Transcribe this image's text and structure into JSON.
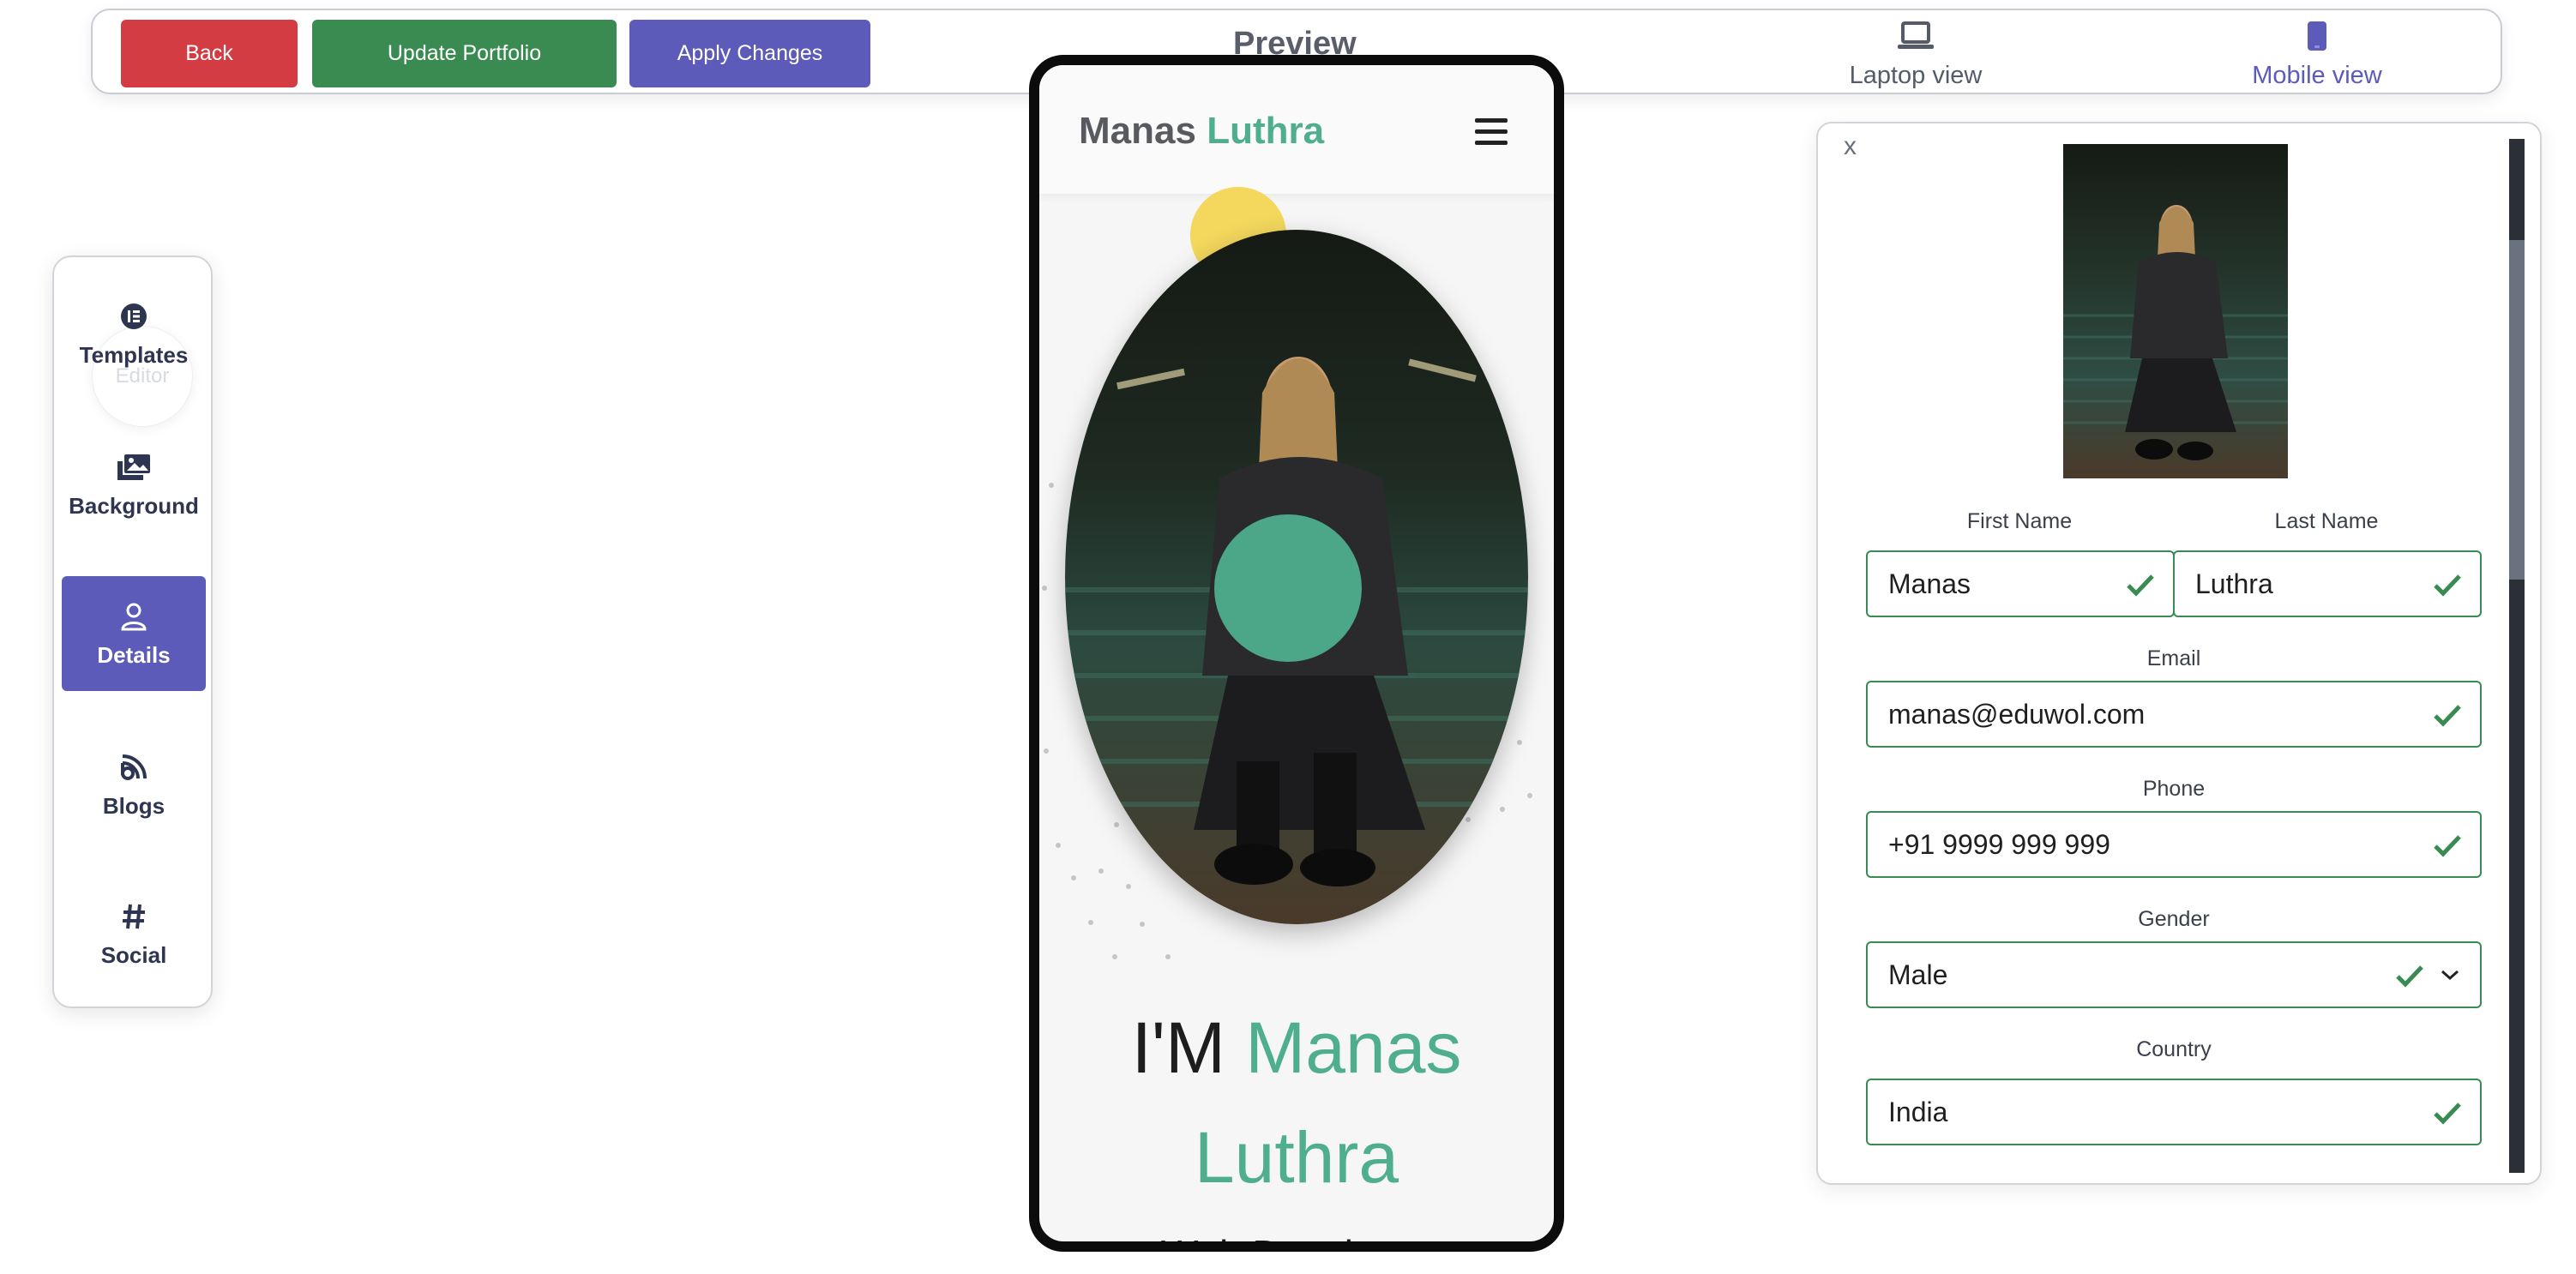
{
  "toolbar": {
    "back_label": "Back",
    "update_label": "Update Portfolio",
    "apply_label": "Apply Changes",
    "preview_title": "Preview",
    "laptop_view_label": "Laptop view",
    "mobile_view_label": "Mobile view",
    "laptop_icon": "laptop-icon",
    "mobile_icon": "mobile-icon",
    "active_view": "Mobile view"
  },
  "sidebar": {
    "ghost_label": "Editor",
    "items": [
      {
        "label": "Templates",
        "icon": "templates-icon",
        "active": false
      },
      {
        "label": "Background",
        "icon": "images-icon",
        "active": false
      },
      {
        "label": "Details",
        "icon": "user-icon",
        "active": true
      },
      {
        "label": "Blogs",
        "icon": "blog-icon",
        "active": false
      },
      {
        "label": "Social",
        "icon": "hashtag-icon",
        "active": false
      }
    ]
  },
  "preview": {
    "brand_first": "Manas",
    "brand_last": "Luthra",
    "hero_prefix": "I'M",
    "hero_first": "Manas",
    "hero_last": "Luthra",
    "subtitle": "Web Developer"
  },
  "details": {
    "close_label": "x",
    "first_name_label": "First Name",
    "first_name_value": "Manas",
    "last_name_label": "Last Name",
    "last_name_value": "Luthra",
    "email_label": "Email",
    "email_value": "manas@eduwol.com",
    "phone_label": "Phone",
    "phone_value": "+91 9999 999 999",
    "gender_label": "Gender",
    "gender_value": "Male",
    "country_label": "Country",
    "country_value": "India"
  },
  "colors": {
    "danger": "#d43c44",
    "success": "#3a8b52",
    "primary": "#5c5bb9",
    "accent": "#4eae8d",
    "yellow": "#f3d85d"
  }
}
